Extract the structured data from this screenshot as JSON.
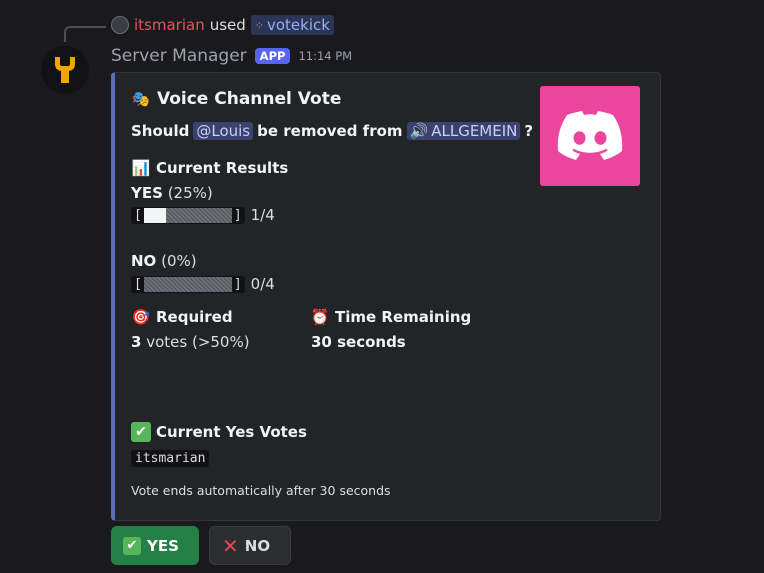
{
  "reply": {
    "user": "itsmarian",
    "used_text": "used",
    "command": "votekick"
  },
  "message": {
    "bot_name": "Server Manager",
    "badge": "APP",
    "timestamp": "11:14 PM"
  },
  "embed": {
    "title": "Voice Channel Vote",
    "question_prefix": "Should",
    "mention_user": "@Louis",
    "question_middle": "be removed from",
    "channel": "ALLGEMEIN",
    "question_suffix": "?",
    "results_title": "Current Results",
    "yes_label": "YES",
    "yes_percent": "(25%)",
    "yes_count": "1/4",
    "yes_fraction": 0.25,
    "no_label": "NO",
    "no_percent": "(0%)",
    "no_count": "0/4",
    "no_fraction": 0,
    "required_title": "Required",
    "required_num": "3",
    "required_text": "votes (>50%)",
    "time_title": "Time Remaining",
    "time_value": "30 seconds",
    "yes_votes_title": "Current Yes Votes",
    "yes_voter": "itsmarian",
    "footer": "Vote ends automatically after 30 seconds",
    "accent_color": "#5c6bc0",
    "thumbnail_color": "#eb459e"
  },
  "buttons": {
    "yes_label": "YES",
    "no_label": "NO"
  }
}
